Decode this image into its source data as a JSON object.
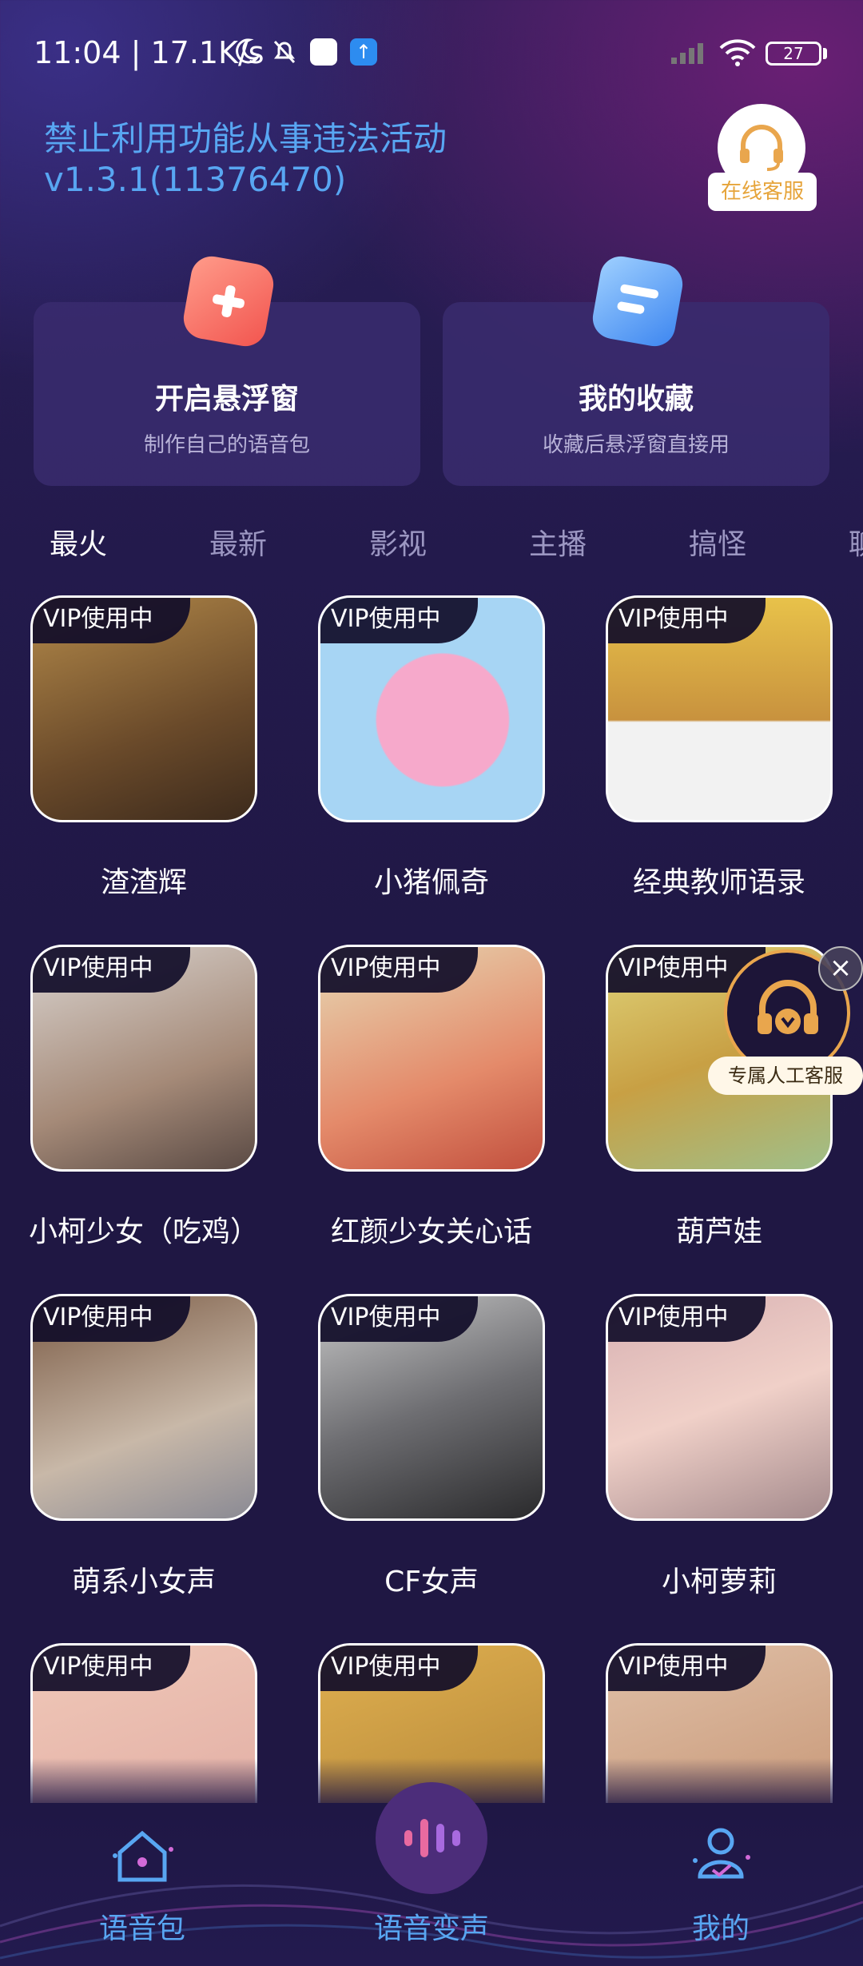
{
  "status_bar": {
    "time": "11:04 | 17.1K/s",
    "battery": "27"
  },
  "header": {
    "warning": "禁止利用功能从事违法活动",
    "version": "v1.3.1(11376470)",
    "customer_service_label": "在线客服"
  },
  "cards": [
    {
      "title": "开启悬浮窗",
      "subtitle": "制作自己的语音包"
    },
    {
      "title": "我的收藏",
      "subtitle": "收藏后悬浮窗直接用"
    }
  ],
  "tabs": [
    "最火",
    "最新",
    "影视",
    "主播",
    "搞怪",
    "聊"
  ],
  "vip_badge": "VIP使用中",
  "grid": [
    {
      "name": "渣渣辉",
      "color": "#8a6a3c"
    },
    {
      "name": "小猪佩奇",
      "color": "#f3a7c8"
    },
    {
      "name": "经典教师语录",
      "color": "#d9b34c"
    },
    {
      "name": "小柯少女（吃鸡）",
      "color": "#a58a78"
    },
    {
      "name": "红颜少女关心话",
      "color": "#d9905a"
    },
    {
      "name": "葫芦娃",
      "color": "#c8a044"
    },
    {
      "name": "萌系小女声",
      "color": "#9c8470"
    },
    {
      "name": "CF女声",
      "color": "#6e6e72"
    },
    {
      "name": "小柯萝莉",
      "color": "#d7b0b2"
    }
  ],
  "partial_grid_colors": [
    "#e3b0a6",
    "#b88a3a",
    "#c99a7a"
  ],
  "float_service": {
    "close": "×",
    "label": "专属人工客服"
  },
  "bottom_nav": [
    {
      "label": "语音包",
      "icon": "home-icon"
    },
    {
      "label": "语音变声",
      "icon": "voice-wave-icon"
    },
    {
      "label": "我的",
      "icon": "user-icon"
    }
  ],
  "colors": {
    "accent_blue": "#58a6f2",
    "gold": "#e9a64d"
  }
}
